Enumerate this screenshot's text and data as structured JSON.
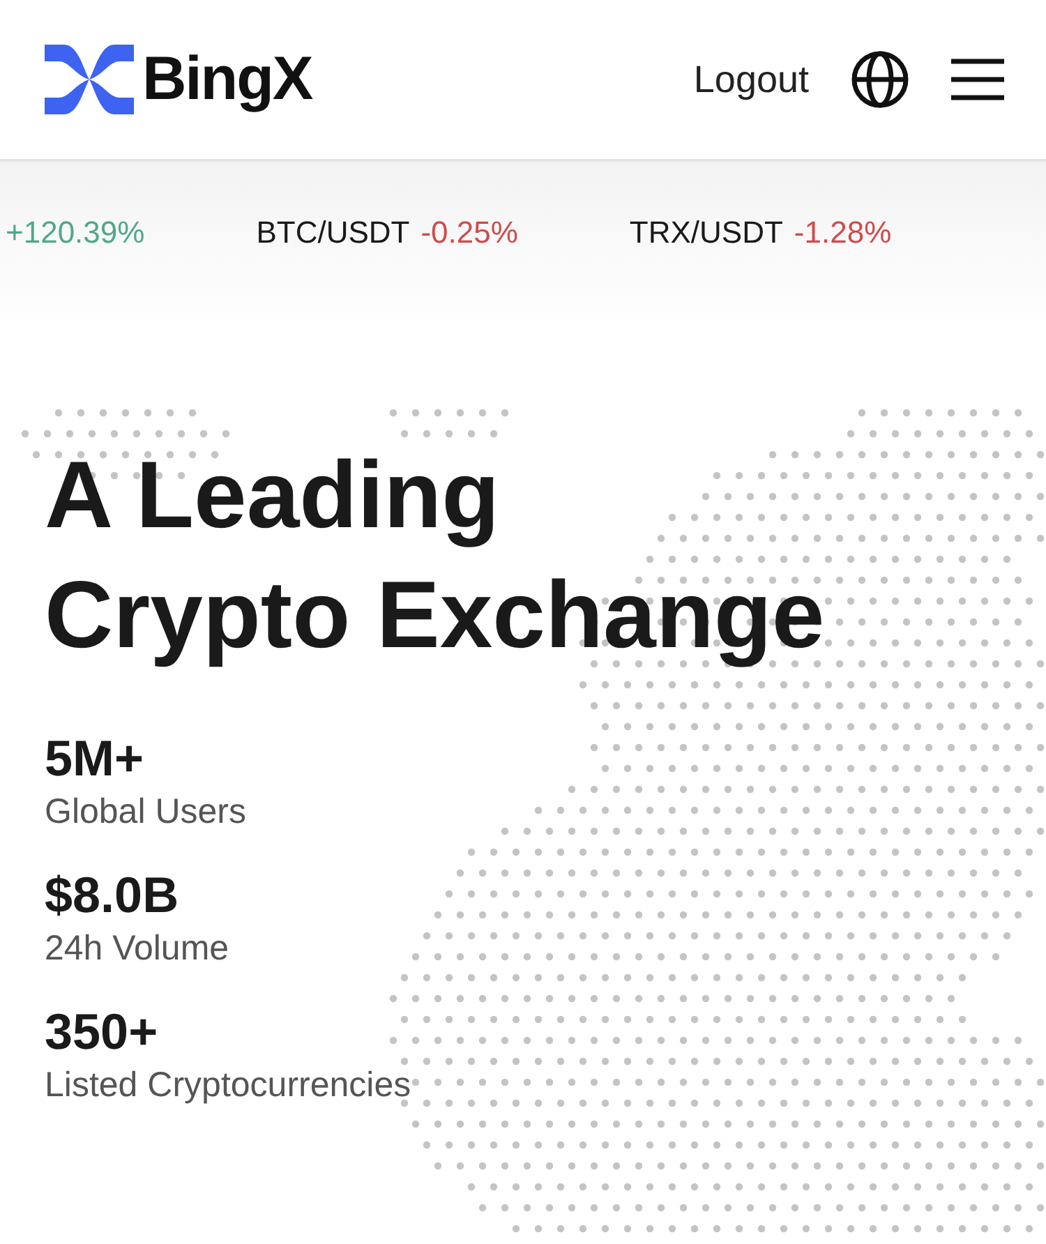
{
  "header": {
    "brand": "BingX",
    "logout": "Logout"
  },
  "ticker": [
    {
      "change": "+120.39%",
      "color": "#4fa88a"
    },
    {
      "pair": "BTC/USDT",
      "change": "-0.25%",
      "color": "#cf4b4b"
    },
    {
      "pair": "TRX/USDT",
      "change": "-1.28%",
      "color": "#cf4b4b"
    }
  ],
  "hero": {
    "title_lines": [
      "A Leading",
      "Crypto Exchange"
    ]
  },
  "stats": [
    {
      "value": "5M+",
      "label": "Global Users"
    },
    {
      "value": "$8.0B",
      "label": "24h Volume"
    },
    {
      "value": "350+",
      "label": "Listed Cryptocurrencies"
    }
  ]
}
